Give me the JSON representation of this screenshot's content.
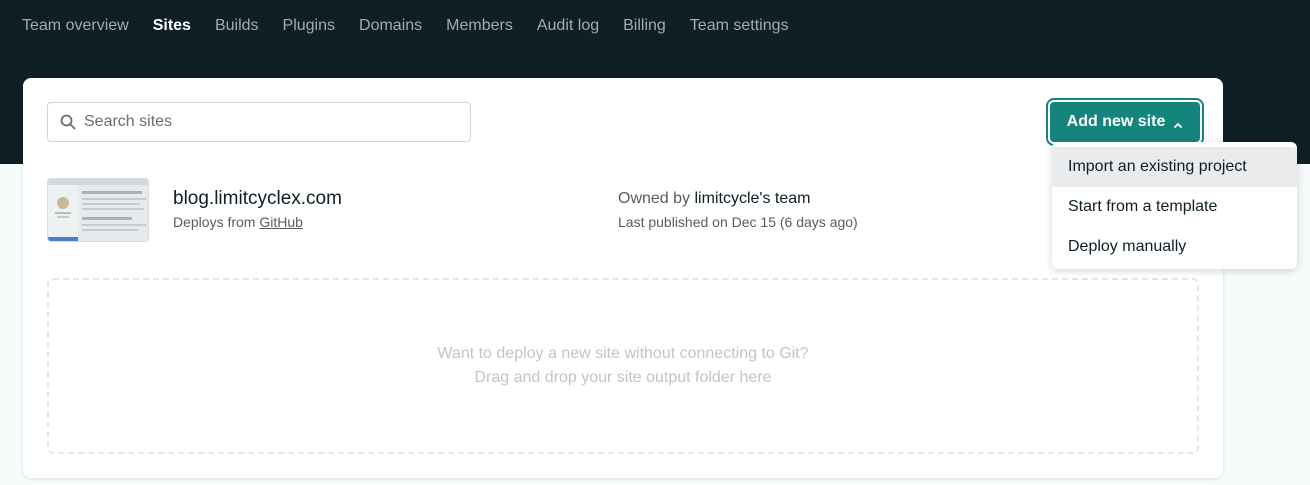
{
  "nav": {
    "items": [
      {
        "label": "Team overview"
      },
      {
        "label": "Sites"
      },
      {
        "label": "Builds"
      },
      {
        "label": "Plugins"
      },
      {
        "label": "Domains"
      },
      {
        "label": "Members"
      },
      {
        "label": "Audit log"
      },
      {
        "label": "Billing"
      },
      {
        "label": "Team settings"
      }
    ],
    "active": "Sites"
  },
  "search": {
    "placeholder": "Search sites",
    "value": ""
  },
  "add_site": {
    "label": "Add new site",
    "menu": [
      {
        "label": "Import an existing project"
      },
      {
        "label": "Start from a template"
      },
      {
        "label": "Deploy manually"
      }
    ]
  },
  "site": {
    "name": "blog.limitcyclex.com",
    "deploys_prefix": "Deploys from",
    "deploys_source": "GitHub",
    "owned_prefix": "Owned by",
    "owner": "limitcycle's team",
    "published": "Last published on Dec 15 (6 days ago)"
  },
  "dropzone": {
    "line1": "Want to deploy a new site without connecting to Git?",
    "line2": "Drag and drop your site output folder here"
  },
  "colors": {
    "header_bg": "#0e1f25",
    "accent": "#15847d",
    "page_bg": "#f6fbfb"
  }
}
